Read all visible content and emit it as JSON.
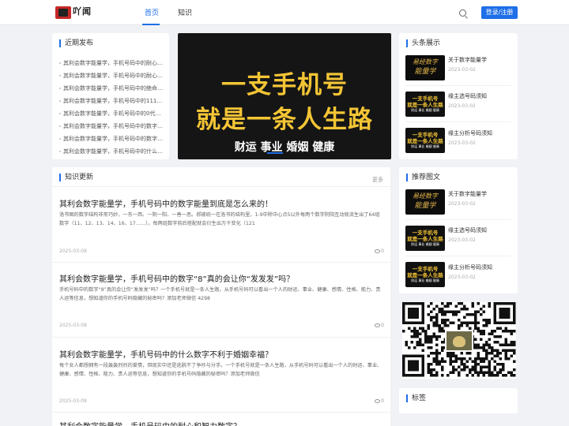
{
  "header": {
    "nav": [
      "首页",
      "知识"
    ],
    "login_label": "登录/注册",
    "logo_text": "吖闻"
  },
  "recent": {
    "title": "近期发布",
    "items": [
      "其利会数字能量学，手机号码中的耐心…",
      "其利会数字能量学，手机号码中的耐心…",
      "其利会数字能量学，手机号码中的绝命…",
      "其利会数字能量学，手机号码中的1117…",
      "其利会数字能量学，手机号码中的0代…",
      "其利会数字能量学，手机号码中的数字…",
      "其利会数字能量学，手机号码中的数字…",
      "其利会数字能量学，手机号码中的什么…"
    ]
  },
  "banner": {
    "line1": "一支手机号",
    "line2": "就是一条人生路",
    "tags": "财运 事业 婚姻 健康"
  },
  "knowledge": {
    "title": "知识更新",
    "more": "更多",
    "articles": [
      {
        "title": "其利会数字能量学，手机号码中的数字能量到底是怎么来的！",
        "desc": "洛书图的数字结构非常巧妙，一东一西、一阴一阳、一善一恶。郝被统一在洛书的结构里，1-9中除中心点5以外每两个数字阴阳互动就流生出了64组数字（11、12、13、14、16、17……）。每两组数字前后搭配就会衍生出万千变化（121",
        "date": "2025-03-09",
        "views": "0"
      },
      {
        "title": "其利会数字能量学，手机号码中的数字“8”真的会让你“发发发”吗？",
        "desc": "手机号码中的数字“8”真的会让你“发发发”吗？一个手机号就是一条人生路，从手机号码可以看出一个人的财运、事业、健康、感情、性格、能力、贵人运等信息，想知道你的手机号码隐藏的秘密吗？添加老师微信 4298",
        "date": "2025-03-09",
        "views": "0"
      },
      {
        "title": "其利会数字能量学，手机号码中的什么数字不利于婚姻幸福？",
        "desc": "每个女人都想拥有一段轰轰烈烈的爱情，但现实中还是逃脱不了争吵与分手。一个手机号就是一条人生路，从手机号码可以看出一个人的财运、事业、健康、感情、性格、能力、贵人运等信息，想知道你的手机号码隐藏的秘密吗？添加老师微信",
        "date": "2025-03-09",
        "views": "0"
      },
      {
        "title": "其利会数字能量学，手机号码中的耐心和智力数字？"
      }
    ]
  },
  "headline": {
    "title": "头条展示",
    "items": [
      {
        "title": "关于数字能量学",
        "date": "2023-03-02"
      },
      {
        "title": "缘主选号码须知",
        "date": "2023-03-02"
      },
      {
        "title": "缘主分析号码须知",
        "date": "2023-03-02"
      }
    ]
  },
  "recommend": {
    "title": "推荐图文",
    "items": [
      {
        "title": "关于数字能量学",
        "date": "2023-03-02"
      },
      {
        "title": "缘主选号码须知",
        "date": "2023-03-02"
      },
      {
        "title": "缘主分析号码须知",
        "date": "2023-03-02"
      }
    ]
  },
  "thumbs": {
    "gold_line1": "易经数字",
    "gold_line2": "能量学",
    "red_line1": "一支手机号",
    "red_line2": "就是一条人生路",
    "red_line3": "财运 事业 婚姻 健康"
  },
  "tags": {
    "title": "标签"
  },
  "colors": {
    "accent": "#1e6fe8",
    "banner_gold": "#f4c535"
  },
  "icons": {
    "search": "search-icon",
    "views": "eye-icon",
    "qr": "qr-code"
  }
}
